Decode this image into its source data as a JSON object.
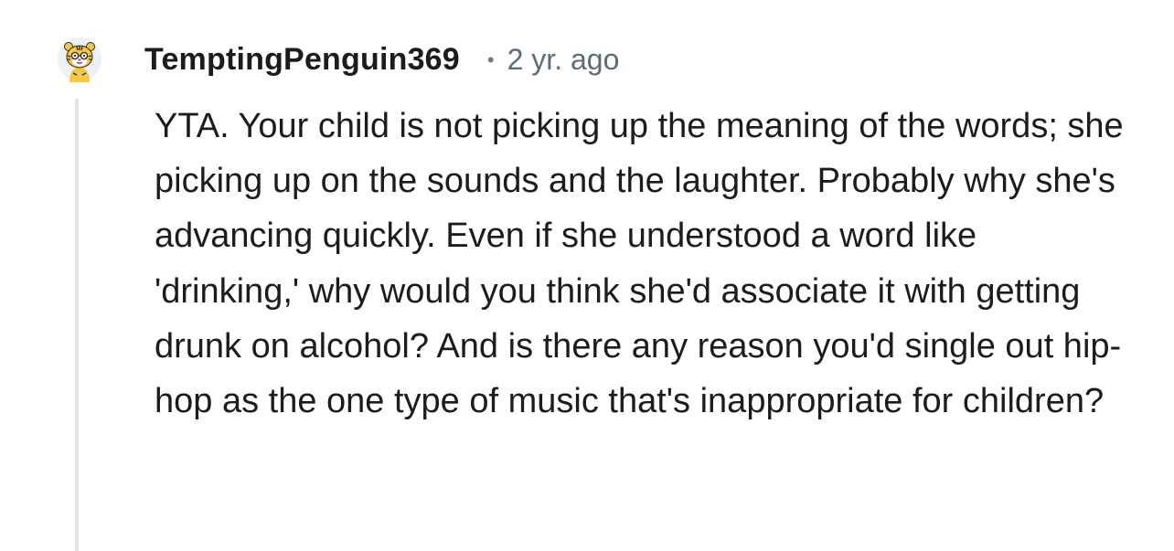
{
  "comment": {
    "author": "TemptingPenguin369",
    "separator": "•",
    "timestamp": "2 yr. ago",
    "avatar_icon": "tiger-snoo-avatar-icon",
    "body": "YTA. Your child is not picking up the meaning of the words; she picking up on the sounds and the laughter. Probably why she's advancing quickly. Even if she understood a word like 'drinking,' why would you think she'd associate it with getting drunk on alcohol? And is there any reason you'd single out hip-hop as the one type of music that's inappropriate for children?"
  },
  "colors": {
    "text": "#1c1c1c",
    "meta": "#5c6c75",
    "thread_line": "#e5e5e5",
    "avatar_yellow": "#f5c842"
  }
}
